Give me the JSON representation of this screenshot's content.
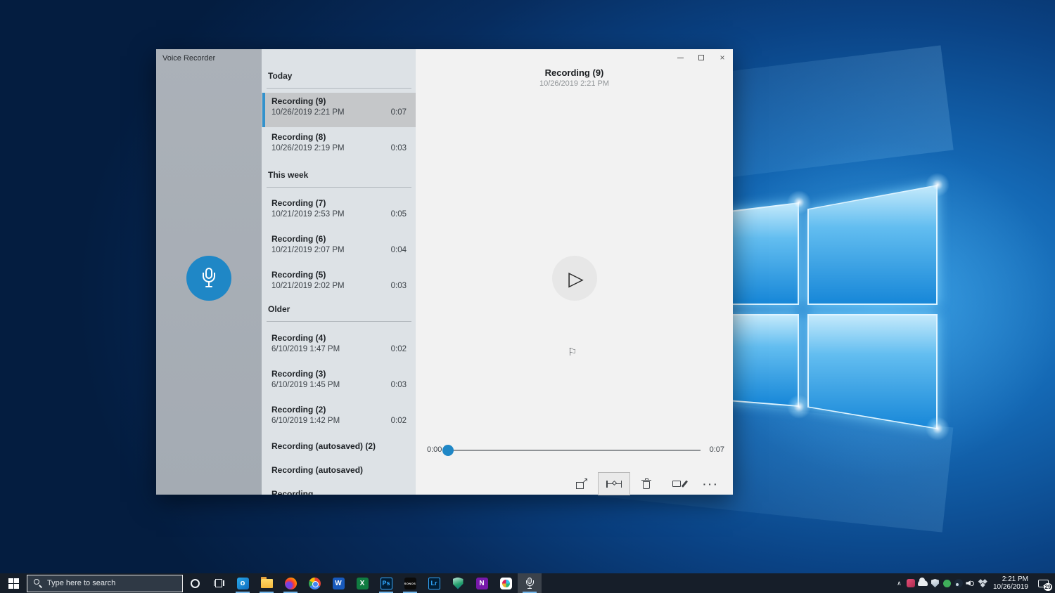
{
  "window": {
    "title": "Voice Recorder",
    "controls": {
      "minimize": "minimize",
      "maximize": "maximize",
      "close": "close"
    }
  },
  "recordings": {
    "sections": [
      {
        "header": "Today",
        "items": [
          {
            "title": "Recording (9)",
            "date": "10/26/2019 2:21 PM",
            "duration": "0:07",
            "selected": true
          },
          {
            "title": "Recording (8)",
            "date": "10/26/2019 2:19 PM",
            "duration": "0:03"
          }
        ]
      },
      {
        "header": "This week",
        "items": [
          {
            "title": "Recording (7)",
            "date": "10/21/2019 2:53 PM",
            "duration": "0:05"
          },
          {
            "title": "Recording (6)",
            "date": "10/21/2019 2:07 PM",
            "duration": "0:04"
          },
          {
            "title": "Recording (5)",
            "date": "10/21/2019 2:02 PM",
            "duration": "0:03"
          }
        ]
      },
      {
        "header": "Older",
        "items": [
          {
            "title": "Recording (4)",
            "date": "6/10/2019 1:47 PM",
            "duration": "0:02"
          },
          {
            "title": "Recording (3)",
            "date": "6/10/2019 1:45 PM",
            "duration": "0:03"
          },
          {
            "title": "Recording (2)",
            "date": "6/10/2019 1:42 PM",
            "duration": "0:02"
          },
          {
            "title": "Recording (autosaved) (2)"
          },
          {
            "title": "Recording (autosaved)"
          },
          {
            "title": "Recording"
          }
        ]
      }
    ]
  },
  "player": {
    "title": "Recording (9)",
    "subtitle": "10/26/2019 2:21 PM",
    "elapsed": "0:00",
    "total": "0:07",
    "accent_color": "#1f87c6",
    "icons": [
      "play-icon",
      "flag-icon"
    ]
  },
  "toolbar": {
    "icons": [
      "share-icon",
      "trim-icon",
      "delete-icon",
      "rename-icon",
      "see-more-icon"
    ],
    "more_label": "• • •"
  },
  "taskbar": {
    "search_placeholder": "Type here to search",
    "apps": [
      {
        "name": "outlook",
        "letter": "o"
      },
      {
        "name": "file-explorer"
      },
      {
        "name": "firefox"
      },
      {
        "name": "chrome"
      },
      {
        "name": "word",
        "letter": "W"
      },
      {
        "name": "excel",
        "letter": "X"
      },
      {
        "name": "photoshop",
        "letter": "Ps"
      },
      {
        "name": "sonos",
        "label": "SONOS"
      },
      {
        "name": "lightroom",
        "letter": "Lr"
      },
      {
        "name": "antivirus-shield"
      },
      {
        "name": "onenote",
        "letter": "N"
      },
      {
        "name": "slack"
      },
      {
        "name": "voice-recorder",
        "active": true
      }
    ],
    "tray_icons": [
      "hidden-icons-chevron",
      "password-manager",
      "onedrive",
      "defender",
      "green-status-app",
      "steam",
      "volume",
      "dropbox"
    ],
    "clock": {
      "time": "2:21 PM",
      "date": "10/26/2019"
    },
    "notification_badge": "29"
  },
  "wallpaper": {
    "theme": "windows-10-hero",
    "base_color": "#0a4284"
  }
}
